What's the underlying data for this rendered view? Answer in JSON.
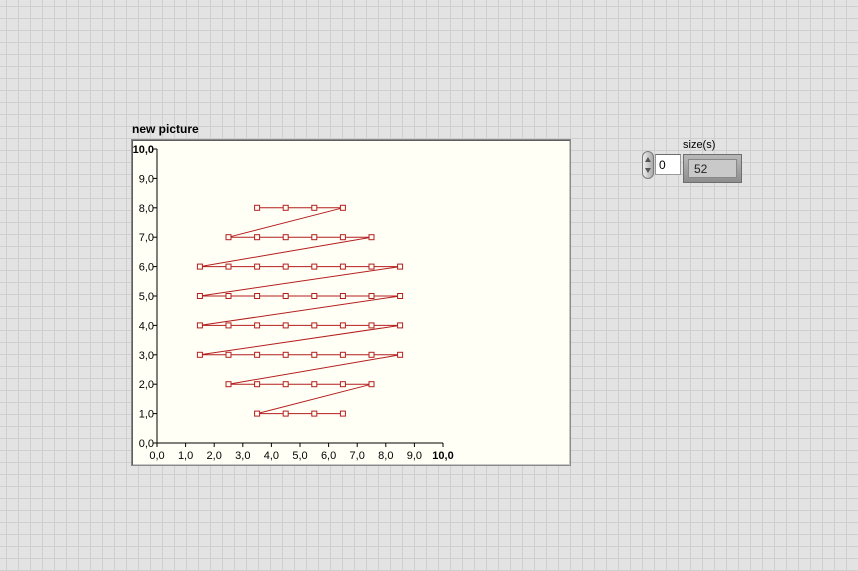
{
  "graph": {
    "title": "new picture"
  },
  "array_control": {
    "index_value": "0"
  },
  "size_indicator": {
    "label": "size(s)",
    "value": "52"
  },
  "colors": {
    "line": "#b41e1e",
    "plot_background": "#fffff6"
  },
  "chart_data": {
    "type": "line",
    "title": "",
    "xlabel": "",
    "ylabel": "",
    "xlim": [
      0,
      10
    ],
    "ylim": [
      0,
      10
    ],
    "x_ticks": [
      "0,0",
      "1,0",
      "2,0",
      "3,0",
      "4,0",
      "5,0",
      "6,0",
      "7,0",
      "8,0",
      "9,0",
      "10,0"
    ],
    "y_ticks": [
      "0,0",
      "1,0",
      "2,0",
      "3,0",
      "4,0",
      "5,0",
      "6,0",
      "7,0",
      "8,0",
      "9,0",
      "10,0"
    ],
    "grid": false,
    "marker": "square",
    "series": [
      {
        "points": [
          [
            3.5,
            8
          ],
          [
            4.5,
            8
          ],
          [
            5.5,
            8
          ],
          [
            6.5,
            8
          ],
          [
            2.5,
            7
          ],
          [
            3.5,
            7
          ],
          [
            4.5,
            7
          ],
          [
            5.5,
            7
          ],
          [
            6.5,
            7
          ],
          [
            7.5,
            7
          ],
          [
            1.5,
            6
          ],
          [
            2.5,
            6
          ],
          [
            3.5,
            6
          ],
          [
            4.5,
            6
          ],
          [
            5.5,
            6
          ],
          [
            6.5,
            6
          ],
          [
            7.5,
            6
          ],
          [
            8.5,
            6
          ],
          [
            1.5,
            5
          ],
          [
            2.5,
            5
          ],
          [
            3.5,
            5
          ],
          [
            4.5,
            5
          ],
          [
            5.5,
            5
          ],
          [
            6.5,
            5
          ],
          [
            7.5,
            5
          ],
          [
            8.5,
            5
          ],
          [
            1.5,
            4
          ],
          [
            2.5,
            4
          ],
          [
            3.5,
            4
          ],
          [
            4.5,
            4
          ],
          [
            5.5,
            4
          ],
          [
            6.5,
            4
          ],
          [
            7.5,
            4
          ],
          [
            8.5,
            4
          ],
          [
            1.5,
            3
          ],
          [
            2.5,
            3
          ],
          [
            3.5,
            3
          ],
          [
            4.5,
            3
          ],
          [
            5.5,
            3
          ],
          [
            6.5,
            3
          ],
          [
            7.5,
            3
          ],
          [
            8.5,
            3
          ],
          [
            2.5,
            2
          ],
          [
            3.5,
            2
          ],
          [
            4.5,
            2
          ],
          [
            5.5,
            2
          ],
          [
            6.5,
            2
          ],
          [
            7.5,
            2
          ],
          [
            3.5,
            1
          ],
          [
            4.5,
            1
          ],
          [
            5.5,
            1
          ],
          [
            6.5,
            1
          ]
        ]
      }
    ]
  }
}
